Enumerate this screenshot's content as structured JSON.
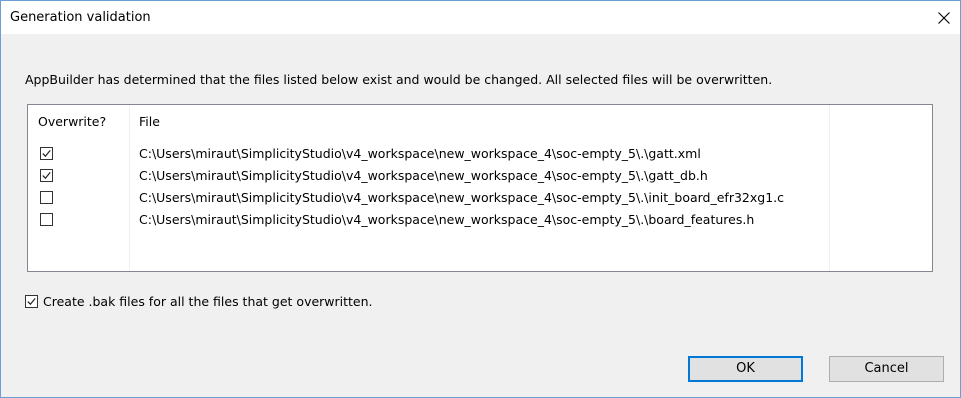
{
  "dialog": {
    "title": "Generation validation",
    "message": "AppBuilder has determined that the files listed below exist and would be changed. All selected files will be overwritten."
  },
  "table": {
    "columns": [
      "Overwrite?",
      "File"
    ],
    "rows": [
      {
        "checked": true,
        "path": "C:\\Users\\miraut\\SimplicityStudio\\v4_workspace\\new_workspace_4\\soc-empty_5\\.\\gatt.xml"
      },
      {
        "checked": true,
        "path": "C:\\Users\\miraut\\SimplicityStudio\\v4_workspace\\new_workspace_4\\soc-empty_5\\.\\gatt_db.h"
      },
      {
        "checked": false,
        "path": "C:\\Users\\miraut\\SimplicityStudio\\v4_workspace\\new_workspace_4\\soc-empty_5\\.\\init_board_efr32xg1.c"
      },
      {
        "checked": false,
        "path": "C:\\Users\\miraut\\SimplicityStudio\\v4_workspace\\new_workspace_4\\soc-empty_5\\.\\board_features.h"
      }
    ]
  },
  "bak_option": {
    "checked": true,
    "label": "Create .bak files for all the files that get overwritten."
  },
  "buttons": {
    "ok": "OK",
    "cancel": "Cancel"
  },
  "colors": {
    "window_border": "#6b9fd4",
    "default_button_border": "#0078d7",
    "dialog_bg": "#f0f0f0"
  }
}
